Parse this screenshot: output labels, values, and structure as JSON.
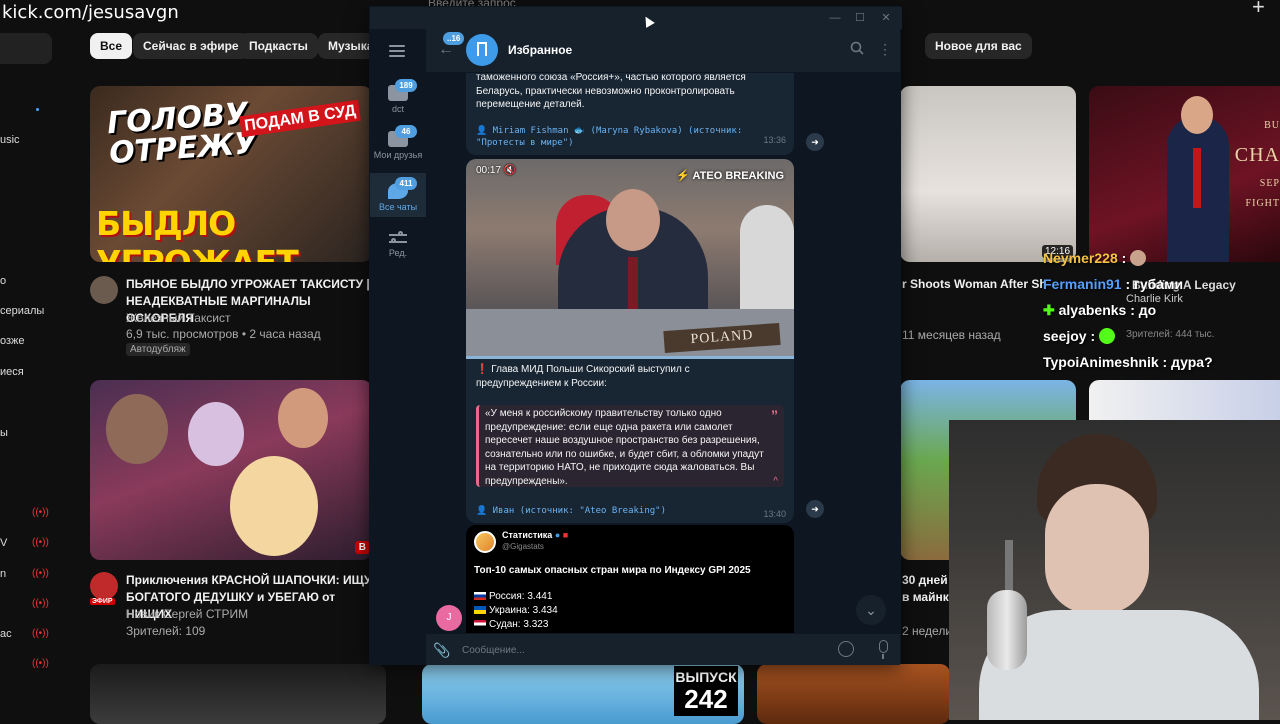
{
  "stream": {
    "watermark": "kick.com/jesusavgn"
  },
  "youtube": {
    "search_placeholder": "Введите запрос",
    "plus_icon": "plus-icon",
    "chips": [
      "Все",
      "Сейчас в эфире",
      "Подкасты",
      "Музыка",
      "о",
      "Новое для вас"
    ],
    "sidebar": [
      "usic",
      "о",
      "сериалы",
      "озже",
      "иеся",
      "ы",
      "V",
      "n",
      "ас"
    ],
    "videos": [
      {
        "thumb_caption_1": "ГОЛОВУ ОТРЕЖУ",
        "thumb_caption_2": "ПОДАМ В СУД",
        "thumb_caption_3": "БЫДЛО УГРОЖАЕТ",
        "title": "ПЬЯНОЕ БЫДЛО УГРОЖАЕТ ТАКСИСТУ | НЕАДЕКВАТНЫЕ МАРГИНАЛЫ ОСКОРБЛЯ",
        "channel": "Железный Таксист",
        "meta": "6,9 тыс. просмотров • 2 часа назад",
        "badge": "Автодубляж"
      },
      {
        "live_badge": "В",
        "avatar_badge": "ЭФИР",
        "title": "Приключения КРАСНОЙ ШАПОЧКИ: ИЩУ БОГАТОГО ДЕДУШКУ и УБЕГАЮ от НИЩИХ",
        "channel": "Новик Сергей СТРИМ",
        "meta": "Зрителей: 109"
      },
      {
        "duration": "12:16",
        "title": "r Shoots Woman After Sh",
        "meta": "11 месяцев назад"
      },
      {
        "brand_1": "BU",
        "brand_2": "CHA",
        "brand_3": "SEP",
        "brand_4": "FIGHT",
        "title": "Building A Legacy",
        "channel": "Charlie Kirk",
        "meta": "Зрителей: 444 тыс."
      },
      {
        "title": "30 дней г",
        "title2": "в майнкр",
        "meta": "2 недели"
      },
      {
        "episode_label": "ВЫПУСК",
        "episode_num": "242"
      }
    ]
  },
  "kick_chat": [
    {
      "user": "Neymer228",
      "text": ":",
      "color": "#f6c343"
    },
    {
      "user": "Fermanin91",
      "text": ": губами",
      "color": "#53a0ff"
    },
    {
      "user": "alyabenks",
      "text": ": до",
      "color": "#ffffff"
    },
    {
      "user": "seejoy",
      "text": ":",
      "color": "#ffffff"
    },
    {
      "user": "TypoiAnimeshnik",
      "text": ": дура?",
      "color": "#ffffff"
    }
  ],
  "telegram": {
    "chat_title": "Избранное",
    "back_badge": "..16",
    "folders": [
      {
        "label": "dct",
        "badge": "189"
      },
      {
        "label": "Мои друзья",
        "badge": "46"
      },
      {
        "label": "Все чаты",
        "badge": "411"
      },
      {
        "label": "Ред.",
        "badge": ""
      }
    ],
    "messages": [
      {
        "text": "таможенного союза «Россия+», частью которого является Беларусь, практически невозможно проконтролировать перемещение деталей.",
        "source": "👤 Miriam Fishman 🐟 (Maryna Rybakova) (источник: \"Протесты в мире\")",
        "time": "13:36"
      },
      {
        "video_time": "00:17",
        "video_brand": "ATEO BREAKING",
        "video_plate": "POLAND",
        "text": "❗ Глава МИД Польши Сикорский выступил с предупреждением к России:",
        "quote": "«У меня к российскому правительству только одно предупреждение: если еще одна ракета или самолет пересечет наше воздушное пространство без разрешения, сознательно или по ошибке, и будет сбит, а обломки упадут на территорию НАТО, не приходите сюда жаловаться. Вы предупреждены».",
        "source": "👤 Иван (источник: \"Ateo Breaking\")",
        "time": "13:40"
      },
      {
        "channel_name": "Статистика",
        "handle": "@Gigastats",
        "title": "Топ-10 самых опасных стран мира по Индексу GPI 2025",
        "rows": [
          "Россия: 3.441",
          "Украина: 3.434",
          "Судан: 3.323"
        ]
      }
    ],
    "user_avatar": "J",
    "input_placeholder": "Сообщение..."
  },
  "colors": {
    "tg_bg": "#0e1621",
    "tg_bubble": "#182533",
    "tg_accent": "#4f9ee0",
    "yt_bg": "#0f0f0f"
  }
}
